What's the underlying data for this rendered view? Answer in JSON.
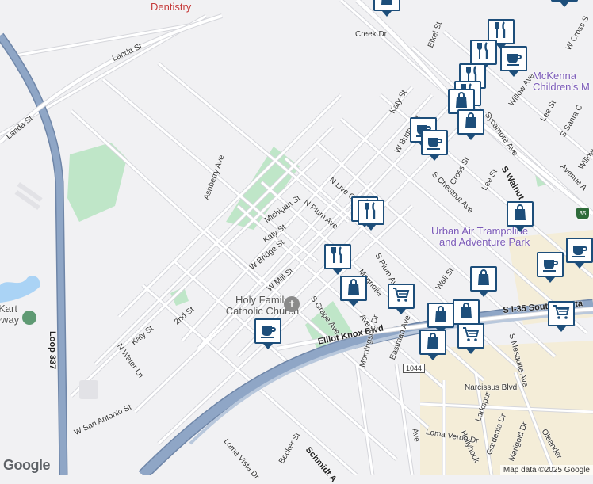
{
  "map": {
    "attribution": "Map data ©2025 Google",
    "logo": "Google",
    "colors": {
      "background": "#f1f1f3",
      "road": "#ffffff",
      "road_outline": "#d5d6db",
      "highway": "#8fa6c6",
      "highway_outline": "#6f86a8",
      "park": "#bfe6c8",
      "commercial": "#f4edd8",
      "water": "#aad3f5",
      "pin_border": "#1d4e7a"
    },
    "labels": {
      "dentistry": "Dentistry",
      "landa_st": "Landa St",
      "landa_st_2": "Landa St",
      "creek_dr": "Creek Dr",
      "eikel_st": "Eikel St",
      "w_cross": "W Cross S",
      "mckenna_1": "McKenna",
      "mckenna_2": "Children's M",
      "katy_st_1": "Katy St",
      "willow_ave": "Willow Ave",
      "lee_st_1": "Lee St",
      "s_santa": "S Santa C",
      "w_bridge_1": "W Bridge St",
      "sycamore": "Sycamore Ave",
      "willow_2": "Willow",
      "ashberry": "Ashberry Ave",
      "n_live_oak": "N Live Oak",
      "cross_st": "Cross St",
      "lee_st_2": "Lee St",
      "s_walnut": "S Walnut Ave",
      "avenue_a": "Avenue A",
      "michigan": "Michigan St",
      "n_plum": "N Plum Ave",
      "s_chestnut": "S Chestnut Ave",
      "i35_shield": "35",
      "katy_st_2": "Katy St",
      "urban_air_1": "Urban Air Trampoline",
      "urban_air_2": "and Adventure Park",
      "w_bridge_2": "W Bridge St",
      "magnolia": "Magnolia",
      "s_plum": "S Plum Ave",
      "wall_st": "Wall St",
      "w_mill": "W Mill St",
      "holy_family": "Holy Family Catholic Church",
      "s_grape": "S Grape Ave",
      "ave_short": "Ave",
      "i35_frontage": "S I-35 South Fronta",
      "elliot_knox": "Elliot Knox Blvd",
      "second_st": "2nd St",
      "katy_st_3": "Katy St",
      "kart": "y Kart",
      "kart2": "eway",
      "loop337": "Loop 337",
      "n_water": "N Water Ln",
      "s_mesquite": "S Mesquite Ave",
      "shield_1044": "1044",
      "eastman": "Eastman Ave",
      "morningside": "Morningside Dr",
      "narcissus": "Narcissus Blvd",
      "w_san_antonio": "W San Antonio St",
      "loma_verde": "Loma Verde Dr",
      "larkspur": "Larkspur",
      "hollyhock": "Hollyhock",
      "gardenia": "Gardenia Dr",
      "marigold": "Marigold Dr",
      "oleander": "Oleander",
      "becker": "Becker St",
      "loma_vista": "Loma Vista Dr",
      "schmidt": "Schmidt A",
      "aveVertical": "Ave"
    },
    "pins": [
      {
        "icon": "shopping-bag"
      },
      {
        "icon": "shopping-bag"
      },
      {
        "icon": "fork-knife"
      },
      {
        "icon": "coffee-cup"
      },
      {
        "icon": "fork-knife"
      },
      {
        "icon": "fork-knife"
      },
      {
        "icon": "fork-knife"
      },
      {
        "icon": "shopping-bag"
      },
      {
        "icon": "shopping-bag"
      },
      {
        "icon": "coffee-cup"
      },
      {
        "icon": "coffee-cup"
      },
      {
        "icon": "fork-knife"
      },
      {
        "icon": "fork-knife"
      },
      {
        "icon": "shopping-bag"
      },
      {
        "icon": "coffee-cup"
      },
      {
        "icon": "fork-knife"
      },
      {
        "icon": "shopping-bag"
      },
      {
        "icon": "shopping-bag"
      },
      {
        "icon": "shopping-cart"
      },
      {
        "icon": "shopping-bag"
      },
      {
        "icon": "shopping-bag"
      },
      {
        "icon": "shopping-cart"
      },
      {
        "icon": "shopping-bag"
      },
      {
        "icon": "shopping-cart"
      },
      {
        "icon": "coffee-cup"
      },
      {
        "icon": "coffee-cup"
      },
      {
        "icon": "shopping-bag"
      }
    ]
  }
}
